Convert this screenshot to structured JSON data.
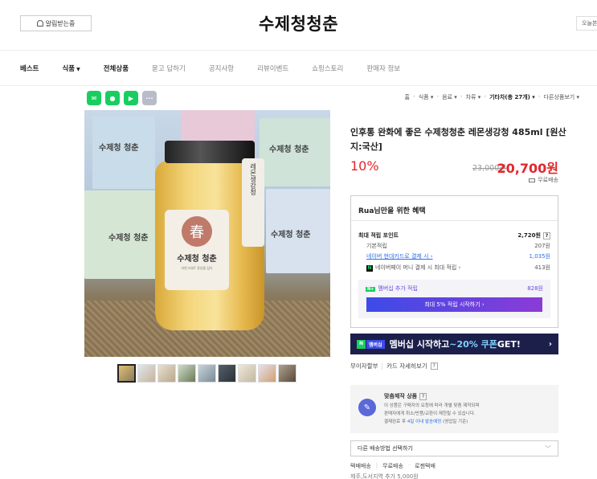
{
  "header": {
    "notify_label": "알림받는중",
    "brand": "수제청청춘",
    "today_label": "오늘본"
  },
  "nav": {
    "items": [
      "베스트",
      "식품",
      "전체상품",
      "묻고 답하기",
      "공지사항",
      "리뷰이벤트",
      "쇼핑스토리",
      "판매자 정보"
    ]
  },
  "share": {
    "icons": [
      "line-icon",
      "kakaostory-icon",
      "band-icon",
      "more-icon"
    ],
    "more_label": "···"
  },
  "breadcrumb": {
    "items": [
      "홈",
      "식품",
      "음료",
      "차류",
      "기타차(총 27개)",
      "다른상품보기"
    ]
  },
  "image": {
    "box_text": "수제청 청춘",
    "jar_tag": "레몬생강청",
    "seal": "春",
    "label_title": "수제청 청춘",
    "label_sub": "자연그대로 정성을 담다"
  },
  "product": {
    "title": "인후통 완화에 좋은 수제청청춘 레몬생강청 485ml [원산지:국산]",
    "discount": "10%",
    "original_price": "23,000원",
    "sale_price": "20,700원",
    "shipping": "무료배송"
  },
  "benefit": {
    "header": "Rua님만을 위한 혜택",
    "max_points_label": "최대 적립 포인트",
    "max_points_value": "2,720원",
    "basic_label": "기본적립",
    "basic_value": "207원",
    "card_label": "네이버 현대카드로 결제 시",
    "card_value": "1,035원",
    "npay_label": "네이버페이 머니 결제 시 최대 적립",
    "npay_value": "413원",
    "member_label": "멤버십 추가 적립",
    "member_value": "828원",
    "member_button": "최대 5% 적립 시작하기 ›"
  },
  "banner": {
    "tag1": "N",
    "tag2": "멤버십",
    "text_before": "멤버십 시작하고 ",
    "text_accent": "~20% 쿠폰",
    "text_after": " GET!"
  },
  "interest": {
    "label": "무이자할부",
    "card_link": "카드 자세히보기"
  },
  "custom": {
    "title": "맞춤제작 상품",
    "line1": "이 상품은 구매자의 요청에 따라 개별 맞춤 제작되며",
    "line2": "판매자에게 취소/반품/교환이 제한될 수 있습니다.",
    "line3_prefix": "결제완료 후 ",
    "line3_highlight": "4일 이내 발송예정",
    "line3_suffix": " (영업일 기준)"
  },
  "shipping": {
    "select_label": "다른 배송방법 선택하기",
    "method": "택배배송",
    "fee": "무료배송",
    "carrier": "로젠택배",
    "extra": "제주,도서지역 추가 5,000원"
  },
  "colors": {
    "sale_red": "#e4262c",
    "naver_green": "#19ce60",
    "member_purple": "#6a4be0",
    "banner_navy": "#1c1f4a"
  }
}
